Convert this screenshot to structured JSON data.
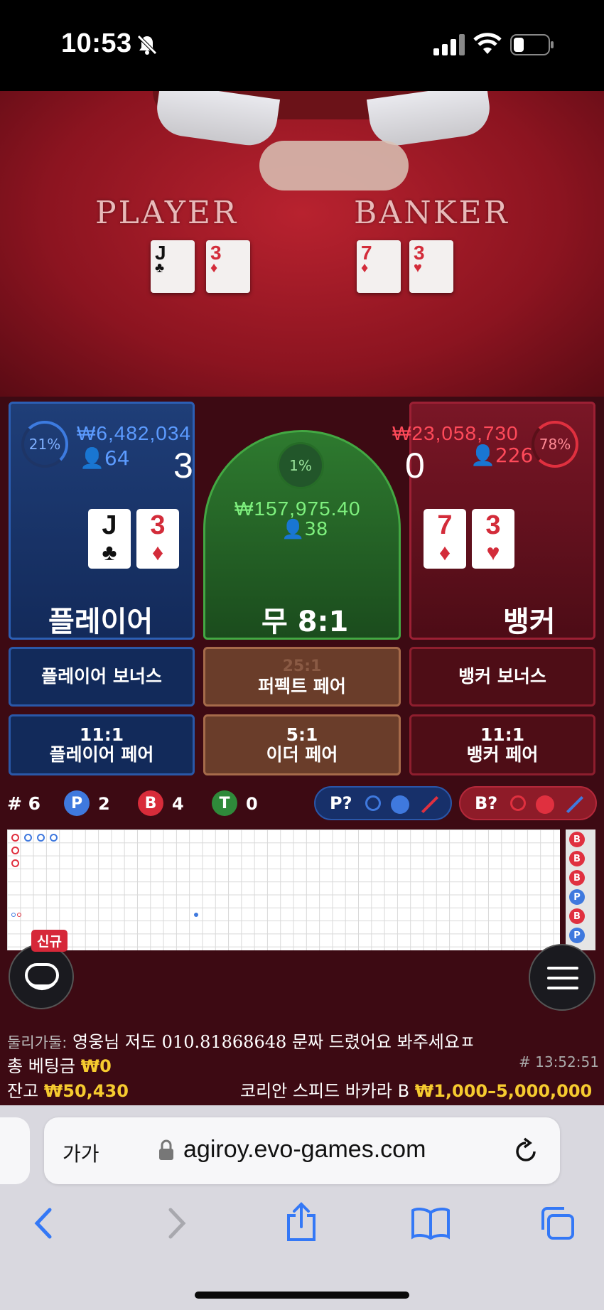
{
  "status_bar": {
    "time": "10:53"
  },
  "table": {
    "player_label": "PLAYER",
    "banker_label": "BANKER",
    "player_cards": [
      {
        "rank": "J",
        "suit": "♣"
      },
      {
        "rank": "3",
        "suit": "♦"
      }
    ],
    "banker_cards": [
      {
        "rank": "7",
        "suit": "♦"
      },
      {
        "rank": "3",
        "suit": "♥"
      }
    ]
  },
  "player": {
    "percent": "21%",
    "amount": "₩6,482,034",
    "users": "64",
    "score": "3",
    "cards": [
      {
        "rank": "J",
        "suit": "♣"
      },
      {
        "rank": "3",
        "suit": "♦"
      }
    ],
    "label": "플레이어"
  },
  "tie": {
    "percent": "1%",
    "amount": "₩157,975.40",
    "users": "38",
    "label": "무 8:1"
  },
  "banker": {
    "percent": "78%",
    "amount": "₩23,058,730",
    "users": "226",
    "score": "0",
    "cards": [
      {
        "rank": "7",
        "suit": "♦"
      },
      {
        "rank": "3",
        "suit": "♥"
      }
    ],
    "label": "뱅커"
  },
  "side_bets": {
    "player_bonus": "플레이어 보너스",
    "perfect_pair_odds": "25:1",
    "perfect_pair": "퍼펙트 페어",
    "banker_bonus": "뱅커 보너스",
    "player_pair_odds": "11:1",
    "player_pair": "플레이어 페어",
    "either_pair_odds": "5:1",
    "either_pair": "이더 페어",
    "banker_pair_odds": "11:1",
    "banker_pair": "뱅커 페어"
  },
  "stats": {
    "round": "# 6",
    "p_letter": "P",
    "p_count": "2",
    "b_letter": "B",
    "b_count": "4",
    "t_letter": "T",
    "t_count": "0",
    "p_predict": "P?",
    "b_predict": "B?"
  },
  "side_road": [
    "B",
    "B",
    "B",
    "P",
    "B",
    "P"
  ],
  "new_badge": "신규",
  "chat": {
    "user": "둘리가둘:",
    "message": "영웅님 저도 010.81868648 문짜 드렸어요 봐주세요ㅍ"
  },
  "total_bet": {
    "label": "총 베팅금",
    "value": "₩0"
  },
  "game_id": "# 13:52:51",
  "balance": {
    "label": "잔고",
    "value": "₩50,430"
  },
  "table_name": "코리안 스피드 바카라 B",
  "limits": "₩1,000–5,000,000",
  "browser": {
    "text_size": "가가",
    "url": "agiroy.evo-games.com"
  },
  "colors": {
    "player_blue": "#2c5fb4",
    "banker_red": "#d32c3a",
    "tie_green": "#43a843",
    "gold": "#f6cb2f",
    "ios_blue": "#3478f6"
  }
}
